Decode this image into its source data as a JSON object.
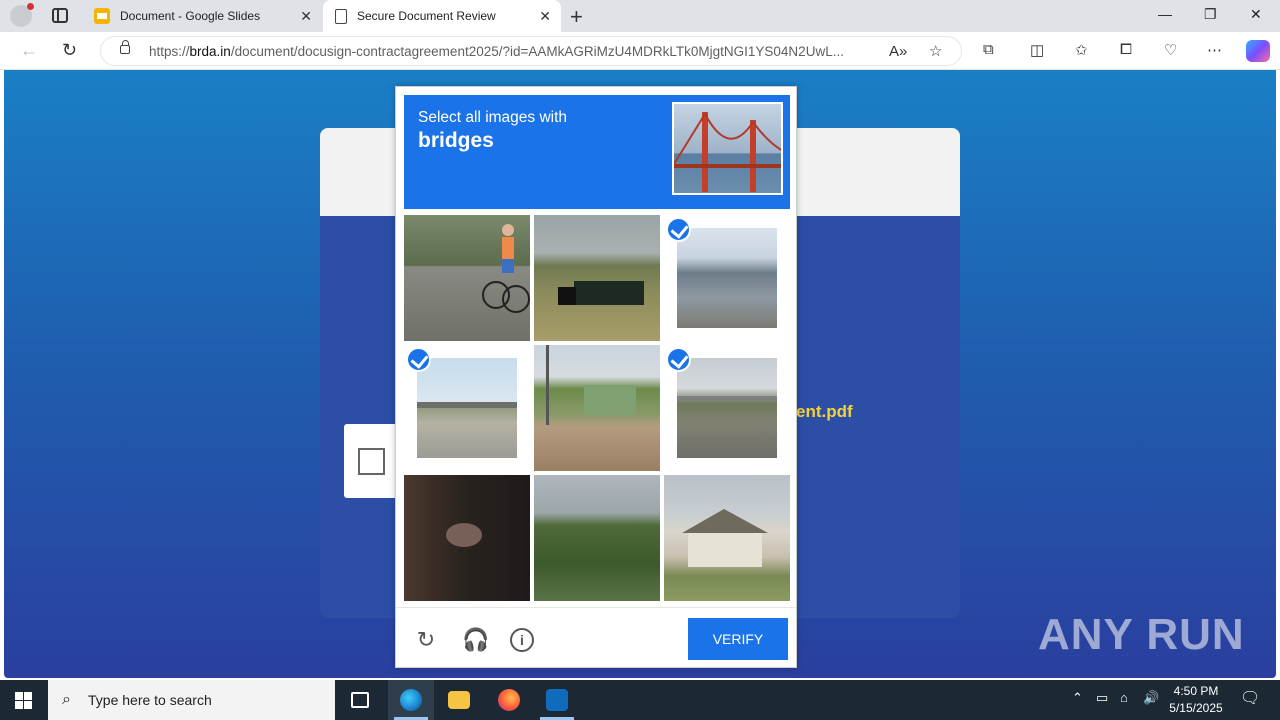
{
  "browser": {
    "tabs": [
      {
        "title": "Document - Google Slides"
      },
      {
        "title": "Secure Document Review"
      }
    ],
    "url_prefix": "https://",
    "url_host": "brda.in",
    "url_rest": "/document/docusign-contractagreement2025/?id=AAMkAGRiMzU4MDRkLTk0MjgtNGI1YS04N2UwL..."
  },
  "page": {
    "pdf_fragment": "ent.pdf",
    "watermark": "ANY RUN"
  },
  "captcha": {
    "prompt": "Select all images with",
    "target": "bridges",
    "verify_label": "VERIFY",
    "tiles": [
      {
        "subject": "cyclist",
        "selected": false
      },
      {
        "subject": "truck-on-road",
        "selected": false
      },
      {
        "subject": "overpass",
        "selected": true
      },
      {
        "subject": "highway-overpass",
        "selected": true
      },
      {
        "subject": "building",
        "selected": false
      },
      {
        "subject": "highway-bridge",
        "selected": true
      },
      {
        "subject": "dark-scene",
        "selected": false
      },
      {
        "subject": "trees",
        "selected": false
      },
      {
        "subject": "house",
        "selected": false
      }
    ]
  },
  "taskbar": {
    "search_placeholder": "Type here to search",
    "time": "4:50 PM",
    "date": "5/15/2025"
  }
}
